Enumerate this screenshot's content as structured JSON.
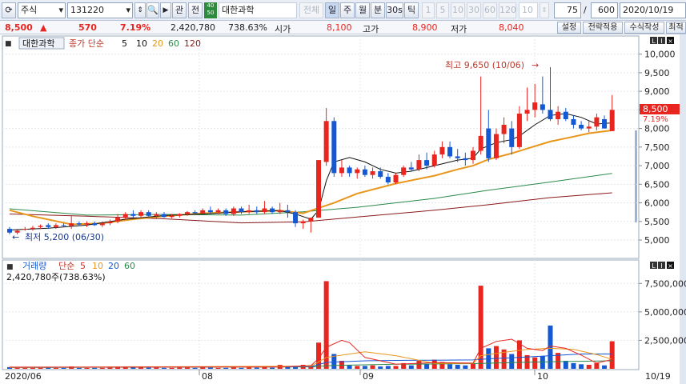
{
  "toolbar": {
    "market": "주식",
    "code": "131220",
    "gwan_label": "관",
    "jeon_label": "전",
    "badge_top": "40",
    "badge_bottom": "50",
    "stock_name": "대한과학",
    "total_label": "전체",
    "period_day": "일",
    "period_week": "주",
    "period_month": "월",
    "period_min": "분",
    "period_30s": "30s",
    "period_tick": "틱",
    "intervals": [
      "1",
      "5",
      "10",
      "30",
      "60",
      "120"
    ],
    "interval_value": "10",
    "count_value": "75",
    "slash": "/",
    "count_total": "600",
    "date_value": "2020/10/19"
  },
  "quote": {
    "price": "8,500",
    "arrow": "▲",
    "change": "570",
    "change_pct": "7.19%",
    "volume": "2,420,780",
    "volume_pct": "738.63%",
    "open_label": "시가",
    "open": "8,100",
    "high_label": "고가",
    "high": "8,900",
    "low_label": "저가",
    "low": "8,040",
    "settings_btn": "설정",
    "strategy_btn": "전략적용",
    "formula_btn": "수식작성",
    "max_btn": "최적"
  },
  "price_panel": {
    "name_box": "대한과학",
    "legend_prefix": "종가 단순",
    "ma": [
      {
        "label": "5",
        "color": "#111111"
      },
      {
        "label": "10",
        "color": "#111111"
      },
      {
        "label": "20",
        "color": "#e8961a"
      },
      {
        "label": "60",
        "color": "#2a8a4a"
      },
      {
        "label": "120",
        "color": "#8b1a1a"
      }
    ],
    "high_annot": "최고 9,650 (10/06)",
    "low_annot": "최저 5,200 (06/30)",
    "price_tag": "8,500",
    "pct_tag": "7.19%",
    "y_ticks": [
      "10,000",
      "9,500",
      "9,000",
      "8,500",
      "8,000",
      "7,500",
      "7,000",
      "6,500",
      "6,000",
      "5,500",
      "5,000"
    ],
    "colors": {
      "up": "#e8251f",
      "down": "#1458d4",
      "ma20": "#e8961a",
      "ma60": "#2a8a4a",
      "ma120": "#8b1a1a"
    }
  },
  "volume_panel": {
    "legend_name": "거래량",
    "legend_prefix": "단순",
    "ma": [
      {
        "label": "5",
        "color": "#e8251f"
      },
      {
        "label": "10",
        "color": "#e8961a"
      },
      {
        "label": "20",
        "color": "#1458d4"
      },
      {
        "label": "60",
        "color": "#2a8a4a"
      }
    ],
    "readout": "2,420,780주(738.63%)",
    "y_ticks": [
      "7,500,000",
      "5,000,000",
      "2,500,000"
    ]
  },
  "x_axis": {
    "labels": [
      "2020/06",
      "08",
      "09",
      "10",
      "10/19"
    ]
  },
  "chart_data": {
    "type": "candlestick",
    "title": "대한과학",
    "ylim": [
      4850,
      10100
    ],
    "volume_ylim": [
      0,
      8100000
    ],
    "candles": [
      {
        "o": 5300,
        "h": 5350,
        "l": 5150,
        "c": 5200,
        "v": 150000
      },
      {
        "o": 5200,
        "h": 5300,
        "l": 5150,
        "c": 5250,
        "v": 90000
      },
      {
        "o": 5300,
        "h": 5350,
        "l": 5250,
        "c": 5300,
        "v": 80000
      },
      {
        "o": 5300,
        "h": 5380,
        "l": 5250,
        "c": 5330,
        "v": 80000
      },
      {
        "o": 5350,
        "h": 5420,
        "l": 5300,
        "c": 5380,
        "v": 80000
      },
      {
        "o": 5400,
        "h": 5450,
        "l": 5300,
        "c": 5350,
        "v": 150000
      },
      {
        "o": 5350,
        "h": 5450,
        "l": 5300,
        "c": 5400,
        "v": 80000
      },
      {
        "o": 5400,
        "h": 5450,
        "l": 5350,
        "c": 5380,
        "v": 80000
      },
      {
        "o": 5380,
        "h": 5650,
        "l": 5300,
        "c": 5450,
        "v": 200000
      },
      {
        "o": 5450,
        "h": 5500,
        "l": 5380,
        "c": 5420,
        "v": 80000
      },
      {
        "o": 5420,
        "h": 5500,
        "l": 5350,
        "c": 5450,
        "v": 80000
      },
      {
        "o": 5450,
        "h": 5500,
        "l": 5380,
        "c": 5400,
        "v": 80000
      },
      {
        "o": 5400,
        "h": 5500,
        "l": 5350,
        "c": 5450,
        "v": 80000
      },
      {
        "o": 5450,
        "h": 5550,
        "l": 5400,
        "c": 5500,
        "v": 100000
      },
      {
        "o": 5500,
        "h": 5700,
        "l": 5450,
        "c": 5600,
        "v": 120000
      },
      {
        "o": 5600,
        "h": 5750,
        "l": 5550,
        "c": 5700,
        "v": 150000
      },
      {
        "o": 5700,
        "h": 5800,
        "l": 5600,
        "c": 5650,
        "v": 120000
      },
      {
        "o": 5650,
        "h": 5800,
        "l": 5600,
        "c": 5750,
        "v": 150000
      },
      {
        "o": 5750,
        "h": 5800,
        "l": 5600,
        "c": 5650,
        "v": 100000
      },
      {
        "o": 5650,
        "h": 5750,
        "l": 5580,
        "c": 5700,
        "v": 100000
      },
      {
        "o": 5700,
        "h": 5750,
        "l": 5600,
        "c": 5620,
        "v": 80000
      },
      {
        "o": 5620,
        "h": 5700,
        "l": 5580,
        "c": 5650,
        "v": 80000
      },
      {
        "o": 5650,
        "h": 5720,
        "l": 5600,
        "c": 5700,
        "v": 100000
      },
      {
        "o": 5700,
        "h": 5780,
        "l": 5650,
        "c": 5750,
        "v": 100000
      },
      {
        "o": 5750,
        "h": 5800,
        "l": 5680,
        "c": 5720,
        "v": 80000
      },
      {
        "o": 5720,
        "h": 5850,
        "l": 5700,
        "c": 5800,
        "v": 120000
      },
      {
        "o": 5800,
        "h": 5900,
        "l": 5720,
        "c": 5750,
        "v": 100000
      },
      {
        "o": 5750,
        "h": 5850,
        "l": 5700,
        "c": 5800,
        "v": 80000
      },
      {
        "o": 5800,
        "h": 5850,
        "l": 5650,
        "c": 5700,
        "v": 80000
      },
      {
        "o": 5700,
        "h": 5900,
        "l": 5650,
        "c": 5850,
        "v": 120000
      },
      {
        "o": 5850,
        "h": 5900,
        "l": 5700,
        "c": 5750,
        "v": 80000
      },
      {
        "o": 5750,
        "h": 5950,
        "l": 5700,
        "c": 5800,
        "v": 120000
      },
      {
        "o": 5800,
        "h": 5900,
        "l": 5700,
        "c": 5750,
        "v": 100000
      },
      {
        "o": 5750,
        "h": 6050,
        "l": 5700,
        "c": 5850,
        "v": 150000
      },
      {
        "o": 5850,
        "h": 5900,
        "l": 5700,
        "c": 5750,
        "v": 100000
      },
      {
        "o": 5750,
        "h": 6000,
        "l": 5700,
        "c": 5800,
        "v": 350000
      },
      {
        "o": 5800,
        "h": 5950,
        "l": 5600,
        "c": 5750,
        "v": 150000
      },
      {
        "o": 5750,
        "h": 5800,
        "l": 5350,
        "c": 5450,
        "v": 250000
      },
      {
        "o": 5450,
        "h": 5550,
        "l": 5300,
        "c": 5500,
        "v": 350000
      },
      {
        "o": 5500,
        "h": 5600,
        "l": 5200,
        "c": 5600,
        "v": 300000
      },
      {
        "o": 5600,
        "h": 7150,
        "l": 5600,
        "c": 7150,
        "v": 2300000
      },
      {
        "o": 7100,
        "h": 8550,
        "l": 7000,
        "c": 8200,
        "v": 7700000
      },
      {
        "o": 8200,
        "h": 8300,
        "l": 6700,
        "c": 6800,
        "v": 1300000
      },
      {
        "o": 6800,
        "h": 7150,
        "l": 6700,
        "c": 6950,
        "v": 700000
      },
      {
        "o": 6950,
        "h": 7000,
        "l": 6700,
        "c": 6800,
        "v": 300000
      },
      {
        "o": 6800,
        "h": 6950,
        "l": 6650,
        "c": 6900,
        "v": 250000
      },
      {
        "o": 6900,
        "h": 7000,
        "l": 6700,
        "c": 6750,
        "v": 250000
      },
      {
        "o": 6750,
        "h": 6950,
        "l": 6650,
        "c": 6850,
        "v": 300000
      },
      {
        "o": 6850,
        "h": 6950,
        "l": 6650,
        "c": 6700,
        "v": 200000
      },
      {
        "o": 6700,
        "h": 6800,
        "l": 6500,
        "c": 6550,
        "v": 250000
      },
      {
        "o": 6550,
        "h": 6800,
        "l": 6500,
        "c": 6750,
        "v": 250000
      },
      {
        "o": 6750,
        "h": 7000,
        "l": 6700,
        "c": 6950,
        "v": 500000
      },
      {
        "o": 6950,
        "h": 7100,
        "l": 6850,
        "c": 6900,
        "v": 300000
      },
      {
        "o": 6900,
        "h": 7300,
        "l": 6850,
        "c": 7150,
        "v": 700000
      },
      {
        "o": 7150,
        "h": 7350,
        "l": 6900,
        "c": 7000,
        "v": 450000
      },
      {
        "o": 7000,
        "h": 7400,
        "l": 6950,
        "c": 7300,
        "v": 800000
      },
      {
        "o": 7300,
        "h": 7650,
        "l": 7200,
        "c": 7500,
        "v": 600000
      },
      {
        "o": 7500,
        "h": 7650,
        "l": 7200,
        "c": 7250,
        "v": 400000
      },
      {
        "o": 7250,
        "h": 7450,
        "l": 7100,
        "c": 7200,
        "v": 350000
      },
      {
        "o": 7200,
        "h": 7350,
        "l": 7000,
        "c": 7150,
        "v": 300000
      },
      {
        "o": 7150,
        "h": 7500,
        "l": 7050,
        "c": 7400,
        "v": 500000
      },
      {
        "o": 7400,
        "h": 9400,
        "l": 7300,
        "c": 7800,
        "v": 7300000
      },
      {
        "o": 8000,
        "h": 8500,
        "l": 7100,
        "c": 7200,
        "v": 1800000
      },
      {
        "o": 7200,
        "h": 8000,
        "l": 7150,
        "c": 7850,
        "v": 2000000
      },
      {
        "o": 7850,
        "h": 8300,
        "l": 7600,
        "c": 8100,
        "v": 1700000
      },
      {
        "o": 8000,
        "h": 8200,
        "l": 7300,
        "c": 7500,
        "v": 1300000
      },
      {
        "o": 7500,
        "h": 8600,
        "l": 7450,
        "c": 8400,
        "v": 2500000
      },
      {
        "o": 8400,
        "h": 9100,
        "l": 8200,
        "c": 8500,
        "v": 1200000
      },
      {
        "o": 8500,
        "h": 9200,
        "l": 8300,
        "c": 8700,
        "v": 1000000
      },
      {
        "o": 8650,
        "h": 9400,
        "l": 8400,
        "c": 8500,
        "v": 1100000
      },
      {
        "o": 8500,
        "h": 9650,
        "l": 8200,
        "c": 8250,
        "v": 3800000
      },
      {
        "o": 8250,
        "h": 8600,
        "l": 8100,
        "c": 8450,
        "v": 1400000
      },
      {
        "o": 8450,
        "h": 8550,
        "l": 8200,
        "c": 8250,
        "v": 700000
      },
      {
        "o": 8250,
        "h": 8350,
        "l": 8000,
        "c": 8100,
        "v": 500000
      },
      {
        "o": 8100,
        "h": 8200,
        "l": 7950,
        "c": 8000,
        "v": 400000
      },
      {
        "o": 8000,
        "h": 8200,
        "l": 7900,
        "c": 8050,
        "v": 350000
      },
      {
        "o": 8050,
        "h": 8400,
        "l": 7950,
        "c": 8300,
        "v": 500000
      },
      {
        "o": 8250,
        "h": 8350,
        "l": 8000,
        "c": 8000,
        "v": 300000
      },
      {
        "o": 7930,
        "h": 8900,
        "l": 8040,
        "c": 8500,
        "v": 2420780
      }
    ],
    "ma5": [
      [
        0,
        5270
      ],
      [
        5,
        5320
      ],
      [
        10,
        5400
      ],
      [
        15,
        5560
      ],
      [
        20,
        5660
      ],
      [
        25,
        5700
      ],
      [
        30,
        5760
      ],
      [
        35,
        5790
      ],
      [
        37,
        5700
      ],
      [
        39,
        5560
      ],
      [
        40,
        5800
      ],
      [
        41,
        6600
      ],
      [
        42,
        7100
      ],
      [
        44,
        7220
      ],
      [
        46,
        7100
      ],
      [
        48,
        6900
      ],
      [
        50,
        6800
      ],
      [
        52,
        6850
      ],
      [
        55,
        7000
      ],
      [
        58,
        7150
      ],
      [
        60,
        7200
      ],
      [
        61,
        7450
      ],
      [
        63,
        7620
      ],
      [
        65,
        7700
      ],
      [
        66,
        7800
      ],
      [
        68,
        8100
      ],
      [
        70,
        8350
      ],
      [
        72,
        8400
      ],
      [
        74,
        8300
      ],
      [
        76,
        8120
      ],
      [
        78,
        8150
      ]
    ],
    "ma20": [
      [
        0,
        5800
      ],
      [
        3,
        5640
      ],
      [
        8,
        5420
      ],
      [
        12,
        5450
      ],
      [
        16,
        5560
      ],
      [
        20,
        5640
      ],
      [
        25,
        5720
      ],
      [
        30,
        5760
      ],
      [
        35,
        5790
      ],
      [
        38,
        5720
      ],
      [
        40,
        5860
      ],
      [
        42,
        6000
      ],
      [
        45,
        6250
      ],
      [
        50,
        6520
      ],
      [
        55,
        6730
      ],
      [
        58,
        6900
      ],
      [
        60,
        7000
      ],
      [
        62,
        7170
      ],
      [
        65,
        7330
      ],
      [
        67,
        7460
      ],
      [
        70,
        7650
      ],
      [
        73,
        7780
      ],
      [
        75,
        7870
      ],
      [
        78,
        7950
      ]
    ],
    "ma60": [
      [
        0,
        5840
      ],
      [
        10,
        5670
      ],
      [
        20,
        5690
      ],
      [
        30,
        5670
      ],
      [
        38,
        5760
      ],
      [
        45,
        5880
      ],
      [
        55,
        6120
      ],
      [
        62,
        6340
      ],
      [
        70,
        6560
      ],
      [
        78,
        6790
      ]
    ],
    "ma120": [
      [
        0,
        5700
      ],
      [
        10,
        5640
      ],
      [
        20,
        5570
      ],
      [
        30,
        5460
      ],
      [
        38,
        5490
      ],
      [
        45,
        5620
      ],
      [
        55,
        5800
      ],
      [
        62,
        5950
      ],
      [
        70,
        6140
      ],
      [
        78,
        6270
      ]
    ],
    "vma5": [
      [
        0,
        150000
      ],
      [
        35,
        160000
      ],
      [
        39,
        280000
      ],
      [
        40,
        900000
      ],
      [
        41,
        1900000
      ],
      [
        43,
        2500000
      ],
      [
        44,
        2300000
      ],
      [
        46,
        1000000
      ],
      [
        50,
        400000
      ],
      [
        55,
        550000
      ],
      [
        60,
        500000
      ],
      [
        61,
        1800000
      ],
      [
        63,
        2400000
      ],
      [
        65,
        2600000
      ],
      [
        67,
        1800000
      ],
      [
        69,
        1600000
      ],
      [
        70,
        2000000
      ],
      [
        72,
        1800000
      ],
      [
        74,
        1200000
      ],
      [
        76,
        500000
      ],
      [
        78,
        820000
      ]
    ],
    "vma10": [
      [
        0,
        130000
      ],
      [
        39,
        230000
      ],
      [
        41,
        1000000
      ],
      [
        44,
        1300000
      ],
      [
        46,
        1500000
      ],
      [
        50,
        1150000
      ],
      [
        55,
        480000
      ],
      [
        60,
        480000
      ],
      [
        61,
        1150000
      ],
      [
        64,
        1450000
      ],
      [
        67,
        1700000
      ],
      [
        70,
        1800000
      ],
      [
        73,
        1700000
      ],
      [
        76,
        1250000
      ],
      [
        78,
        820000
      ]
    ],
    "vma20": [
      [
        0,
        130000
      ],
      [
        39,
        180000
      ],
      [
        41,
        560000
      ],
      [
        46,
        700000
      ],
      [
        50,
        740000
      ],
      [
        55,
        760000
      ],
      [
        60,
        780000
      ],
      [
        62,
        880000
      ],
      [
        66,
        1000000
      ],
      [
        70,
        1150000
      ],
      [
        74,
        1300000
      ],
      [
        78,
        1300000
      ]
    ],
    "vma60": [
      [
        0,
        110000
      ],
      [
        39,
        170000
      ],
      [
        42,
        300000
      ],
      [
        50,
        400000
      ],
      [
        60,
        460000
      ],
      [
        66,
        560000
      ],
      [
        72,
        640000
      ],
      [
        78,
        700000
      ]
    ]
  }
}
